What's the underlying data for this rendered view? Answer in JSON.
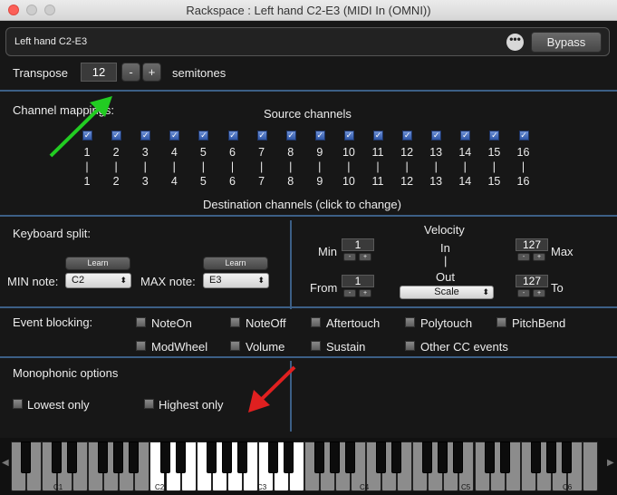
{
  "window": {
    "title": "Rackspace : Left hand C2-E3 (MIDI In (OMNI))"
  },
  "header": {
    "name": "Left hand C2-E3",
    "more_icon": "ellipsis-icon",
    "bypass": "Bypass"
  },
  "transpose": {
    "label": "Transpose",
    "value": "12",
    "minus": "-",
    "plus": "+",
    "unit": "semitones"
  },
  "channels": {
    "section_label": "Channel mappings:",
    "source_title": "Source channels",
    "source": [
      "1",
      "2",
      "3",
      "4",
      "5",
      "6",
      "7",
      "8",
      "9",
      "10",
      "11",
      "12",
      "13",
      "14",
      "15",
      "16"
    ],
    "arrow": "|",
    "destination": [
      "1",
      "2",
      "3",
      "4",
      "5",
      "6",
      "7",
      "8",
      "9",
      "10",
      "11",
      "12",
      "13",
      "14",
      "15",
      "16"
    ],
    "dest_title": "Destination channels (click to change)"
  },
  "split": {
    "label": "Keyboard split:",
    "learn": "Learn",
    "min_label": "MIN note:",
    "min_value": "C2",
    "max_label": "MAX note:",
    "max_value": "E3"
  },
  "velocity": {
    "title": "Velocity",
    "min_label": "Min",
    "min_value": "1",
    "from_label": "From",
    "from_value": "1",
    "in_label": "In",
    "arrow": "|",
    "out_label": "Out",
    "out_value": "Scale",
    "max_value": "127",
    "max_label": "Max",
    "to_value": "127",
    "to_label": "To",
    "dec": "-",
    "inc": "+"
  },
  "blocking": {
    "label": "Event blocking:",
    "items": [
      "NoteOn",
      "NoteOff",
      "Aftertouch",
      "Polytouch",
      "PitchBend",
      "ModWheel",
      "Volume",
      "Sustain",
      "Other CC events"
    ]
  },
  "mono": {
    "label": "Monophonic options",
    "lowest": "Lowest only",
    "highest": "Highest only"
  },
  "keyboard": {
    "labels": [
      "C1",
      "C2",
      "C3",
      "C4",
      "C5",
      "C6"
    ],
    "left_arrow": "◀",
    "right_arrow": "▶"
  },
  "annotations": {
    "green_arrow": "#22cc22",
    "red_arrow": "#e02020"
  },
  "colors": {
    "section_divider": "#3c5f86",
    "checkbox_checked": "#3a64b8",
    "selected_keys": "#ffffff"
  }
}
